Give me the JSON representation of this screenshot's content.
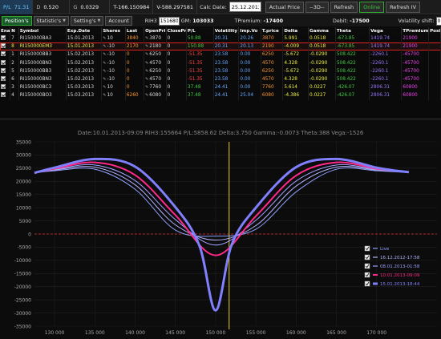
{
  "topbar": {
    "pl_label": "P/L",
    "pl_value": "71.31",
    "d_label": "D",
    "d_value": "0.520",
    "g_label": "G",
    "g_value": "0.0329",
    "t_value": "T-166.150984",
    "v_value": "V-588.297581",
    "calc_label": "Calc Date:",
    "calc_value": "25.12.2012",
    "actual_price": "Actual Price",
    "nav": "--3D--",
    "refresh": "Refresh",
    "online": "Online",
    "refresh_iv": "Refresh IV"
  },
  "tabbar": {
    "tabs": [
      "Position's",
      "Statistic's",
      "Setting's",
      "Account"
    ],
    "instrument": "RIH3",
    "price_value": "151680",
    "gm_label": "GM:",
    "gm_value": "103033",
    "tpremium_label": "TPremium:",
    "tpremium_value": "-17400",
    "debit_label": "Debit:",
    "debit_value": "-17500",
    "vol_shift_label": "Volatility shift:",
    "vol_shift_value": "0"
  },
  "table": {
    "columns": [
      "Enal",
      "N",
      "Symbol",
      "Exp.Date",
      "Shares",
      "Last",
      "OpenPri",
      "ClosePri",
      "P/L",
      "Volatility",
      "Imp.Vo",
      "T.price",
      "Delta",
      "Gamma",
      "Theta",
      "Vega",
      "TPremium",
      "Posi"
    ],
    "rows": [
      {
        "n": "7",
        "symbol": "RI150000BA3",
        "exp": "15.01.2013",
        "shares": "10",
        "last": "3840",
        "open": "3870",
        "close": "0",
        "pl": "50.88",
        "vol": "20.31",
        "imp": "20.26",
        "tprice": "3870",
        "delta": "5.991",
        "gamma": "0.0518",
        "theta": "-673.85",
        "vega": "1419.74",
        "tprem": "21900",
        "selected": false
      },
      {
        "n": "8",
        "symbol": "RI150000EM3",
        "exp": "15.01.2013",
        "shares": "-10",
        "last": "2170",
        "open": "2180",
        "close": "0",
        "pl": "150.88",
        "vol": "20.31",
        "imp": "20.13",
        "tprice": "2190",
        "delta": "-4.009",
        "gamma": "0.0518",
        "theta": "-673.85",
        "vega": "1419.74",
        "tprem": "21900",
        "selected": true
      },
      {
        "n": "1",
        "symbol": "RI150000BB3",
        "exp": "15.02.2013",
        "shares": "-10",
        "last": "0",
        "open": "6250",
        "close": "0",
        "pl": "-51.35",
        "vol": "23.58",
        "imp": "0.00",
        "tprice": "6250",
        "delta": "-5.672",
        "gamma": "-0.0290",
        "theta": "508.422",
        "vega": "-2260.1",
        "tprem": "-45700",
        "selected": false
      },
      {
        "n": "2",
        "symbol": "RI150000BN3",
        "exp": "15.02.2013",
        "shares": "-10",
        "last": "0",
        "open": "4570",
        "close": "0",
        "pl": "-51.35",
        "vol": "23.58",
        "imp": "0.00",
        "tprice": "4570",
        "delta": "4.328",
        "gamma": "-0.0290",
        "theta": "508.422",
        "vega": "-2260.1",
        "tprem": "-45700",
        "selected": false
      },
      {
        "n": "5",
        "symbol": "RI150000BB3",
        "exp": "15.02.2013",
        "shares": "-10",
        "last": "0",
        "open": "6250",
        "close": "0",
        "pl": "-51.35",
        "vol": "23.58",
        "imp": "0.00",
        "tprice": "6250",
        "delta": "-5.672",
        "gamma": "-0.0290",
        "theta": "508.422",
        "vega": "-2260.1",
        "tprem": "-45700",
        "selected": false
      },
      {
        "n": "6",
        "symbol": "RI150000BN3",
        "exp": "15.02.2013",
        "shares": "-10",
        "last": "0",
        "open": "4570",
        "close": "0",
        "pl": "-51.35",
        "vol": "23.58",
        "imp": "0.00",
        "tprice": "4570",
        "delta": "4.328",
        "gamma": "-0.0290",
        "theta": "508.422",
        "vega": "-2260.1",
        "tprem": "-45700",
        "selected": false
      },
      {
        "n": "3",
        "symbol": "RI150000BC3",
        "exp": "15.03.2013",
        "shares": "10",
        "last": "0",
        "open": "7760",
        "close": "0",
        "pl": "37.48",
        "vol": "24.41",
        "imp": "0.00",
        "tprice": "7760",
        "delta": "5.614",
        "gamma": "0.0227",
        "theta": "-426.07",
        "vega": "2806.31",
        "tprem": "60800",
        "selected": false
      },
      {
        "n": "4",
        "symbol": "RI150000BO3",
        "exp": "15.03.2013",
        "shares": "10",
        "last": "6260",
        "open": "6080",
        "close": "0",
        "pl": "37.48",
        "vol": "24.41",
        "imp": "25.04",
        "tprice": "6080",
        "delta": "-4.386",
        "gamma": "0.0227",
        "theta": "-426.07",
        "vega": "2806.31",
        "tprem": "60800",
        "selected": false
      }
    ]
  },
  "chart_data": {
    "type": "line",
    "title": "Date:10.01.2013-09:09  RIH3:155664  P/L:5858.62  Delta:3.750  Gamma:-0.0073  Theta:388  Vega:-1526",
    "xlim": [
      127500,
      177500
    ],
    "ylim": [
      -35000,
      35000
    ],
    "x_ticks": [
      130000,
      135000,
      140000,
      145000,
      150000,
      155000,
      160000,
      165000,
      170000
    ],
    "x_tick_labels": [
      "130 000",
      "135 000",
      "140 000",
      "145 000",
      "150 000",
      "155 000",
      "160 000",
      "165 000",
      "170 000"
    ],
    "y_ticks": [
      35000,
      30000,
      25000,
      20000,
      15000,
      10000,
      5000,
      0,
      -5000,
      -10000,
      -15000,
      -20000,
      -25000,
      -30000,
      -35000
    ],
    "marker_x": 151680,
    "zero_line": true,
    "series": [
      {
        "name": "Live",
        "color": "#8fa0ff",
        "width": 1,
        "x": [
          127500,
          130000,
          135000,
          140000,
          145000,
          150000,
          155000,
          160000,
          165000,
          170000,
          172500,
          174000
        ],
        "y": [
          23200,
          24000,
          24600,
          17000,
          1500,
          -800,
          1800,
          16000,
          24600,
          24000,
          23600,
          23500
        ]
      },
      {
        "name": "16.12.2012-17:58",
        "color": "#b4b4ff",
        "width": 1,
        "x": [
          127500,
          130000,
          135000,
          140000,
          145000,
          150000,
          155000,
          160000,
          165000,
          170000,
          172500,
          174000
        ],
        "y": [
          23200,
          24300,
          25400,
          18700,
          3500,
          -2300,
          3200,
          18200,
          25400,
          24300,
          23700,
          23500
        ]
      },
      {
        "name": "08.01.2013-01:58",
        "color": "#a0a0ff",
        "width": 1,
        "x": [
          127500,
          130000,
          135000,
          140000,
          145000,
          150000,
          155000,
          160000,
          165000,
          170000,
          172500,
          174000
        ],
        "y": [
          23200,
          24500,
          26200,
          20300,
          5500,
          -4200,
          5200,
          20100,
          26200,
          24500,
          23800,
          23500
        ]
      },
      {
        "name": "10.01.2013-09:09",
        "color": "#ff2a8a",
        "width": 2,
        "x": [
          127500,
          130000,
          135000,
          140000,
          145000,
          150000,
          155000,
          160000,
          165000,
          170000,
          172500,
          174000
        ],
        "y": [
          23200,
          24800,
          27200,
          22400,
          7200,
          -8100,
          6800,
          22200,
          27200,
          24800,
          23900,
          23500
        ]
      },
      {
        "name": "15.01.2013-18:44",
        "color": "#8080ff",
        "width": 3,
        "x": [
          127500,
          130000,
          135000,
          140000,
          145000,
          148000,
          150000,
          152000,
          155000,
          160000,
          165000,
          170000,
          172500,
          174000
        ],
        "y": [
          23200,
          25200,
          28500,
          25600,
          10200,
          -4500,
          -29000,
          -4000,
          10000,
          25400,
          28500,
          25200,
          24000,
          23500
        ]
      }
    ]
  }
}
